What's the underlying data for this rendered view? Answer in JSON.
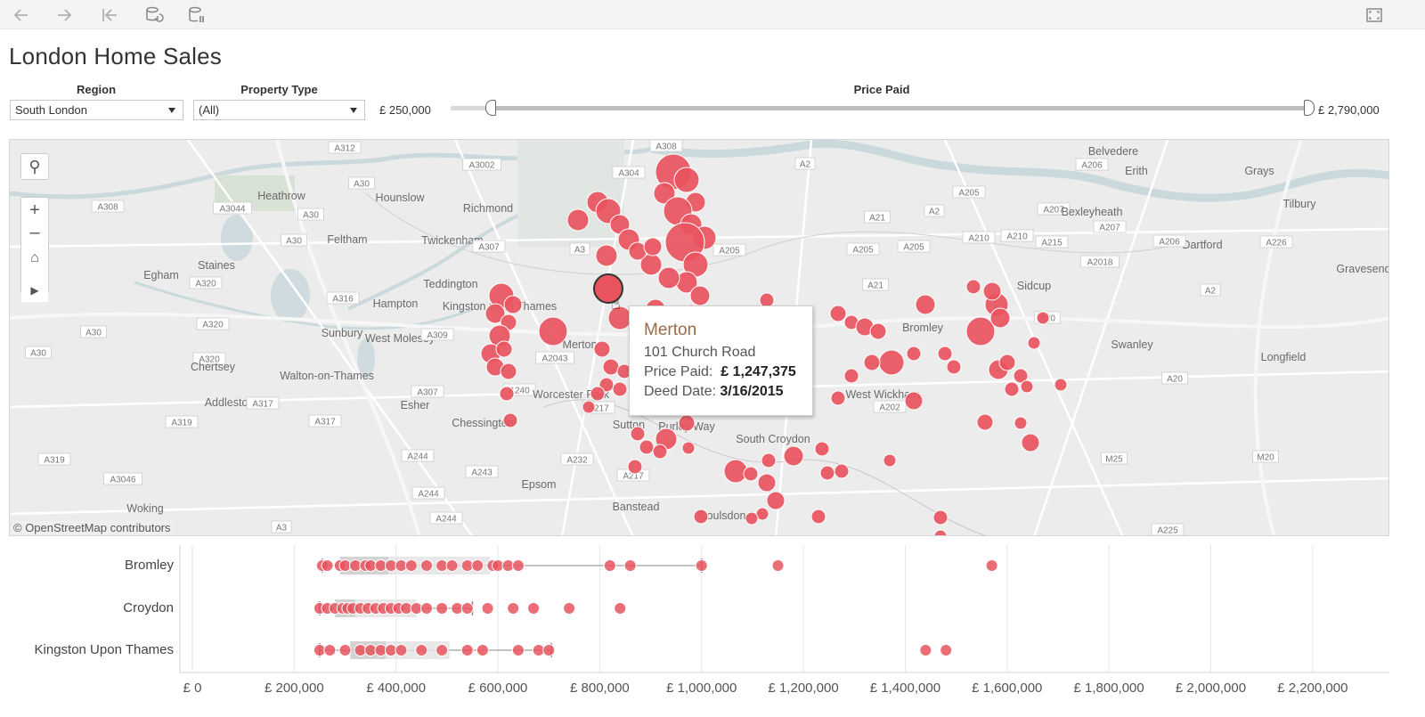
{
  "toolbar": {
    "buttons": [
      "back-icon",
      "forward-icon",
      "revert-icon",
      "refresh-icon",
      "pause-icon",
      "fullscreen-icon"
    ]
  },
  "title": "London Home Sales",
  "filters": {
    "region_label": "Region",
    "region_value": "South London",
    "property_label": "Property Type",
    "property_value": "(All)",
    "price_label": "Price Paid",
    "price_min": "£ 250,000",
    "price_max": "£ 2,790,000"
  },
  "map": {
    "credit": "© OpenStreetMap contributors",
    "places": [
      {
        "t": "A312",
        "x": 376,
        "y": 9
      },
      {
        "t": "A308",
        "x": 737,
        "y": 7
      },
      {
        "t": "A3002",
        "x": 530,
        "y": 28
      },
      {
        "t": "A304",
        "x": 695,
        "y": 37
      },
      {
        "t": "Hounslow",
        "x": 438,
        "y": 65
      },
      {
        "t": "A2",
        "x": 893,
        "y": 27
      },
      {
        "t": "A206",
        "x": 1215,
        "y": 28
      },
      {
        "t": "Belvedere",
        "x": 1239,
        "y": 13
      },
      {
        "t": "Erith",
        "x": 1265,
        "y": 35
      },
      {
        "t": "Grays",
        "x": 1403,
        "y": 35
      },
      {
        "t": "A30",
        "x": 395,
        "y": 49
      },
      {
        "t": "Heathrow",
        "x": 305,
        "y": 63
      },
      {
        "t": "Richmond",
        "x": 537,
        "y": 77
      },
      {
        "t": "A205",
        "x": 1077,
        "y": 59
      },
      {
        "t": "A308",
        "x": 110,
        "y": 75
      },
      {
        "t": "A3044",
        "x": 250,
        "y": 77
      },
      {
        "t": "A30",
        "x": 338,
        "y": 84
      },
      {
        "t": "A2",
        "x": 1038,
        "y": 80
      },
      {
        "t": "A207",
        "x": 1172,
        "y": 78
      },
      {
        "t": "Bexleyheath",
        "x": 1215,
        "y": 81
      },
      {
        "t": "Tilbury",
        "x": 1448,
        "y": 72
      },
      {
        "t": "A21",
        "x": 974,
        "y": 87
      },
      {
        "t": "A30",
        "x": 319,
        "y": 113
      },
      {
        "t": "Feltham",
        "x": 379,
        "y": 112
      },
      {
        "t": "Twickenham",
        "x": 497,
        "y": 113
      },
      {
        "t": "A207",
        "x": 1235,
        "y": 98
      },
      {
        "t": "Dartford",
        "x": 1339,
        "y": 118
      },
      {
        "t": "A210",
        "x": 1131,
        "y": 108
      },
      {
        "t": "A210",
        "x": 1088,
        "y": 110
      },
      {
        "t": "A205",
        "x": 1015,
        "y": 120
      },
      {
        "t": "A206",
        "x": 1302,
        "y": 114
      },
      {
        "t": "A226",
        "x": 1422,
        "y": 115
      },
      {
        "t": "A205",
        "x": 808,
        "y": 124
      },
      {
        "t": "A205",
        "x": 958,
        "y": 123
      },
      {
        "t": "A215",
        "x": 1170,
        "y": 115
      },
      {
        "t": "A307",
        "x": 538,
        "y": 120
      },
      {
        "t": "Staines",
        "x": 232,
        "y": 141
      },
      {
        "t": "A3",
        "x": 640,
        "y": 123
      },
      {
        "t": "A2018",
        "x": 1224,
        "y": 137
      },
      {
        "t": "Egham",
        "x": 170,
        "y": 152
      },
      {
        "t": "Teddington",
        "x": 495,
        "y": 162
      },
      {
        "t": "A320",
        "x": 220,
        "y": 161
      },
      {
        "t": "A21",
        "x": 972,
        "y": 163
      },
      {
        "t": "Sidcup",
        "x": 1150,
        "y": 164
      },
      {
        "t": "Gravesend",
        "x": 1520,
        "y": 145
      },
      {
        "t": "A2",
        "x": 1348,
        "y": 169
      },
      {
        "t": "A316",
        "x": 374,
        "y": 178
      },
      {
        "t": "Hampton",
        "x": 433,
        "y": 184
      },
      {
        "t": "Kingston upon Thames",
        "x": 550,
        "y": 187
      },
      {
        "t": "A20",
        "x": 1165,
        "y": 200
      },
      {
        "t": "A30",
        "x": 94,
        "y": 216
      },
      {
        "t": "A320",
        "x": 228,
        "y": 207
      },
      {
        "t": "Sunbury",
        "x": 373,
        "y": 217
      },
      {
        "t": "West Molesey",
        "x": 438,
        "y": 223
      },
      {
        "t": "A309",
        "x": 480,
        "y": 219
      },
      {
        "t": "Bromley",
        "x": 1025,
        "y": 211
      },
      {
        "t": "Swanley",
        "x": 1260,
        "y": 230
      },
      {
        "t": "A30",
        "x": 32,
        "y": 239
      },
      {
        "t": "A320",
        "x": 224,
        "y": 246
      },
      {
        "t": "Chertsey",
        "x": 228,
        "y": 255
      },
      {
        "t": "A2043",
        "x": 612,
        "y": 245
      },
      {
        "t": "Longfield",
        "x": 1430,
        "y": 244
      },
      {
        "t": "Walton-on-Thames",
        "x": 356,
        "y": 265
      },
      {
        "t": "A240",
        "x": 572,
        "y": 281
      },
      {
        "t": "Worcester Park",
        "x": 630,
        "y": 286
      },
      {
        "t": "West Wickham",
        "x": 980,
        "y": 286
      },
      {
        "t": "A20",
        "x": 1308,
        "y": 268
      },
      {
        "t": "A307",
        "x": 469,
        "y": 283
      },
      {
        "t": "Addlestone",
        "x": 250,
        "y": 295
      },
      {
        "t": "A317",
        "x": 284,
        "y": 296
      },
      {
        "t": "Esher",
        "x": 455,
        "y": 298
      },
      {
        "t": "A217",
        "x": 661,
        "y": 301
      },
      {
        "t": "A202",
        "x": 988,
        "y": 300
      },
      {
        "t": "A319",
        "x": 193,
        "y": 317
      },
      {
        "t": "A317",
        "x": 354,
        "y": 316
      },
      {
        "t": "Chessington",
        "x": 531,
        "y": 318
      },
      {
        "t": "Sutton",
        "x": 695,
        "y": 320
      },
      {
        "t": "Purley Way",
        "x": 760,
        "y": 322
      },
      {
        "t": "South Croydon",
        "x": 857,
        "y": 336
      },
      {
        "t": "A319",
        "x": 50,
        "y": 359
      },
      {
        "t": "A244",
        "x": 458,
        "y": 355
      },
      {
        "t": "A232",
        "x": 637,
        "y": 359
      },
      {
        "t": "A243",
        "x": 530,
        "y": 373
      },
      {
        "t": "A217",
        "x": 700,
        "y": 377
      },
      {
        "t": "M25",
        "x": 1240,
        "y": 358
      },
      {
        "t": "M20",
        "x": 1410,
        "y": 356
      },
      {
        "t": "A3046",
        "x": 127,
        "y": 381
      },
      {
        "t": "Epsom",
        "x": 594,
        "y": 387
      },
      {
        "t": "A244",
        "x": 470,
        "y": 397
      },
      {
        "t": "Woking",
        "x": 152,
        "y": 414
      },
      {
        "t": "A244",
        "x": 490,
        "y": 425
      },
      {
        "t": "Banstead",
        "x": 703,
        "y": 412
      },
      {
        "t": "Coulsdon",
        "x": 800,
        "y": 422
      },
      {
        "t": "A3",
        "x": 305,
        "y": 435
      },
      {
        "t": "A225",
        "x": 1300,
        "y": 438
      },
      {
        "t": "Merton",
        "x": 640,
        "y": 230
      }
    ]
  },
  "tooltip": {
    "name": "Merton",
    "address": "101 Church Road",
    "price_label": "Price Paid:",
    "price_value": "£ 1,247,375",
    "date_label": "Deed Date:",
    "date_value": "3/16/2015"
  },
  "chart_data": {
    "type": "scatter",
    "title": "",
    "xlabel": "",
    "ylabel": "",
    "xlim": [
      0,
      2300000
    ],
    "x_ticks": [
      "£ 0",
      "£ 200,000",
      "£ 400,000",
      "£ 600,000",
      "£ 800,000",
      "£ 1,000,000",
      "£ 1,200,000",
      "£ 1,400,000",
      "£ 1,600,000",
      "£ 1,800,000",
      "£ 2,000,000",
      "£ 2,200,000"
    ],
    "x_tick_values": [
      0,
      200000,
      400000,
      600000,
      800000,
      1000000,
      1200000,
      1400000,
      1600000,
      1800000,
      2000000,
      2200000
    ],
    "grid": true,
    "series": [
      {
        "name": "Bromley",
        "box": {
          "whisker_low": 255000,
          "q1": 290000,
          "median": 385000,
          "q3": 585000,
          "whisker_high": 1000000
        },
        "values": [
          255000,
          265000,
          290000,
          300000,
          320000,
          340000,
          350000,
          370000,
          390000,
          410000,
          430000,
          460000,
          490000,
          510000,
          540000,
          560000,
          590000,
          600000,
          620000,
          640000,
          820000,
          860000,
          1000000,
          1150000,
          1570000
        ]
      },
      {
        "name": "Croydon",
        "box": {
          "whisker_low": 250000,
          "q1": 280000,
          "median": 320000,
          "q3": 440000,
          "whisker_high": 550000
        },
        "values": [
          250000,
          265000,
          280000,
          295000,
          305000,
          315000,
          330000,
          345000,
          360000,
          375000,
          390000,
          405000,
          420000,
          440000,
          460000,
          490000,
          520000,
          540000,
          580000,
          630000,
          670000,
          740000,
          840000
        ]
      },
      {
        "name": "Kingston Upon Thames",
        "box": {
          "whisker_low": 250000,
          "q1": 310000,
          "median": 380000,
          "q3": 505000,
          "whisker_high": 705000
        },
        "values": [
          250000,
          270000,
          300000,
          330000,
          350000,
          370000,
          390000,
          410000,
          450000,
          490000,
          540000,
          570000,
          640000,
          680000,
          700000,
          1440000,
          1480000
        ]
      }
    ]
  },
  "colors": {
    "dot": "#e8545e",
    "dot_stroke": "#ffffff",
    "box": "#d8d8d8",
    "tooltip_name": "#9b6a49"
  }
}
